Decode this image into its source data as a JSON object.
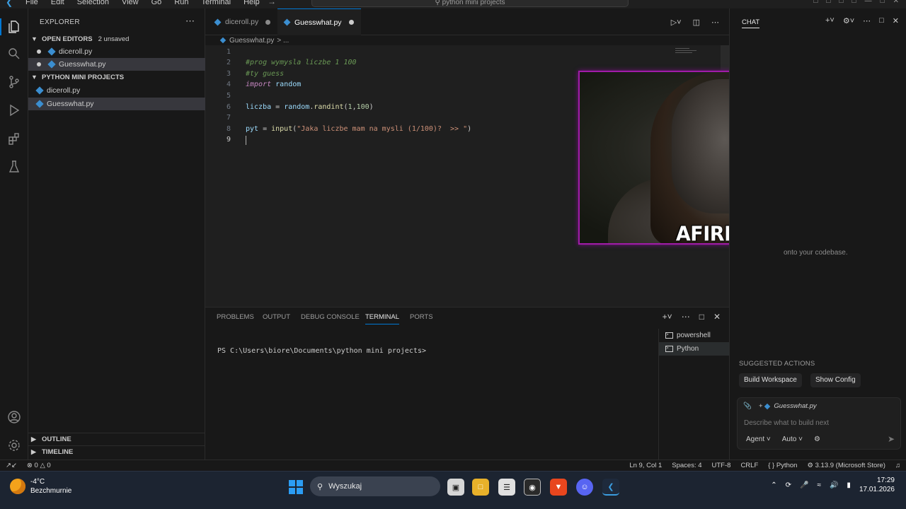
{
  "titlebar": {
    "menu": [
      "File",
      "Edit",
      "Selection",
      "View",
      "Go",
      "Run",
      "Terminal",
      "Help"
    ],
    "search_text": "python mini projects"
  },
  "sidebar": {
    "title": "EXPLORER",
    "open_editors": {
      "label": "OPEN EDITORS",
      "badge": "2 unsaved",
      "files": [
        "diceroll.py",
        "Guesswhat.py"
      ]
    },
    "project": {
      "label": "PYTHON MINI PROJECTS",
      "files": [
        "diceroll.py",
        "Guesswhat.py"
      ]
    },
    "outline_label": "OUTLINE",
    "timeline_label": "TIMELINE"
  },
  "tabs": [
    {
      "label": "diceroll.py"
    },
    {
      "label": "Guesswhat.py"
    }
  ],
  "breadcrumb": {
    "file": "Guesswhat.py",
    "rest": "> ..."
  },
  "editor": {
    "line_numbers": [
      "1",
      "2",
      "3",
      "4",
      "5",
      "6",
      "7",
      "8",
      "9"
    ],
    "line2": "#prog wymysla liczbe 1 100",
    "line3": "#ty guess",
    "line4_kw": "import",
    "line4_mod": "random",
    "line6_var": "liczba",
    "line6_eq": " = ",
    "line6_obj": "random",
    "line6_dot": ".",
    "line6_fn": "randint",
    "line6_open": "(",
    "line6_a": "1",
    "line6_comma": ",",
    "line6_b": "100",
    "line6_close": ")",
    "line8_var": "pyt",
    "line8_eq": " = ",
    "line8_fn": "input",
    "line8_open": "(",
    "line8_str": "\"Jaka liczbe mam na mysli (1/100)?  >> \"",
    "line8_close": ")"
  },
  "webcam": {
    "caption": "AFIRMACJA"
  },
  "panel": {
    "tabs": [
      "PROBLEMS",
      "OUTPUT",
      "DEBUG CONSOLE",
      "TERMINAL",
      "PORTS"
    ],
    "prompt": "PS C:\\Users\\biore\\Documents\\python mini projects>",
    "terminals": [
      "powershell",
      "Python"
    ]
  },
  "chat": {
    "title": "CHAT",
    "hint": "onto your codebase.",
    "suggested_title": "SUGGESTED ACTIONS",
    "actions": [
      "Build Workspace",
      "Show Config"
    ],
    "context_file": "Guesswhat.py",
    "placeholder": "Describe what to build next",
    "agent": "Agent",
    "model": "Auto"
  },
  "statusbar": {
    "errors": "0",
    "warnings": "0",
    "position": "Ln 9, Col 1",
    "spaces": "Spaces: 4",
    "encoding": "UTF-8",
    "eol": "CRLF",
    "language": "Python",
    "interpreter": "3.13.9 (Microsoft Store)"
  },
  "taskbar": {
    "temp": "-4°C",
    "weather": "Bezchmurnie",
    "search": "Wyszukaj",
    "time": "17:29",
    "date": "17.01.2026"
  },
  "colors": {
    "accent": "#0078d4",
    "webcam_border": "#a01ca8",
    "keyword": "#c586c0",
    "comment": "#6a9955"
  }
}
